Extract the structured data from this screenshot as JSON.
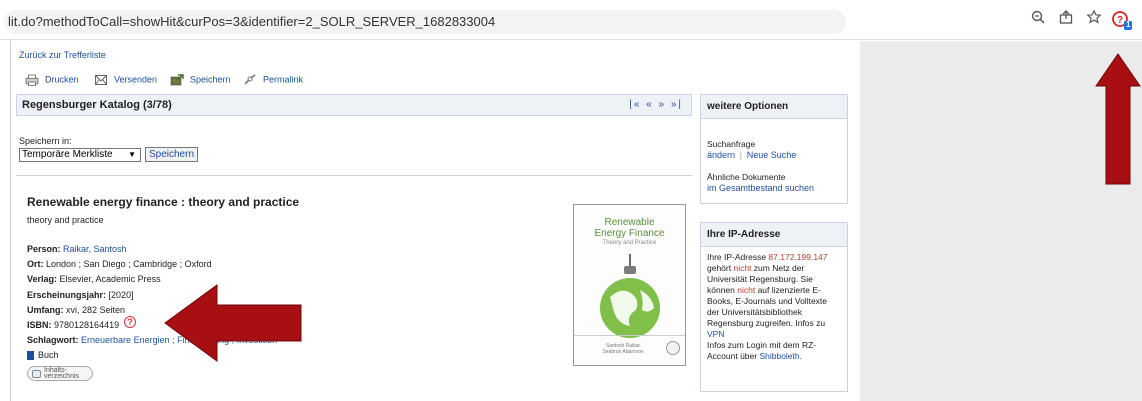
{
  "browser": {
    "url": "lit.do?methodToCall=showHit&curPos=3&identifier=2_SOLR_SERVER_1682833004",
    "ext_badge": "1"
  },
  "nav": {
    "back": "Zurück zur Trefferliste"
  },
  "toolbar": {
    "print": "Drucken",
    "send": "Versenden",
    "save": "Speichern",
    "permalink": "Permalink"
  },
  "catalog": {
    "title": "Regensburger Katalog (3/78)",
    "nav": "|« « » »|"
  },
  "save_form": {
    "label": "Speichern in:",
    "selected": "Temporäre Merkliste",
    "button": "Speichern"
  },
  "record": {
    "title": "Renewable energy finance :  theory and practice",
    "subtitle": "theory and practice",
    "person_label": "Person:",
    "person": "Raikar, Santosh",
    "place_label": "Ort:",
    "place": "London ; San Diego ; Cambridge ; Oxford",
    "publisher_label": "Verlag:",
    "publisher": "Elsevier, Academic Press",
    "year_label": "Erscheinungsjahr:",
    "year": "[2020]",
    "extent_label": "Umfang:",
    "extent": "xvi, 282 Seiten",
    "isbn_label": "ISBN:",
    "isbn": "9780128164419",
    "keyword_label": "Schlagwort:",
    "keywords": "Erneuerbare Energien ; Finanzierung ; Investition",
    "type": "Buch",
    "toc_badge": "Inhalts-verzeichnis"
  },
  "cover": {
    "line1": "Renewable",
    "line2": "Energy Finance",
    "line3": "Theory and Practice",
    "authors": "Santosh Raikar\nSeabron Adamson"
  },
  "options": {
    "title": "weitere Optionen",
    "search_label": "Suchanfrage",
    "change": "ändern",
    "new_search": "Neue Suche",
    "similar_label": "Ähnliche Dokumente",
    "similar_link": "im Gesamtbestand suchen"
  },
  "ip": {
    "title": "Ihre IP-Adresse",
    "t1": "Ihre IP-Adresse ",
    "address": "87.172.199.147",
    "t2": "gehört ",
    "not1": "nicht",
    "t3": " zum Netz der Universität Regensburg. Sie können ",
    "not2": "nicht",
    "t4": " auf lizenzierte E-Books, E-Journals und Volltexte der Universitätsbibliothek Regensburg zugreifen. Infos zu",
    "vpn": "VPN",
    "t5": "Infos zum Login mit dem RZ-Account über ",
    "shib": "Shibboleth",
    "t6": "."
  },
  "colors": {
    "link": "#1b4f9c",
    "arrow": "#a80f12",
    "panel": "#eef1f6"
  }
}
